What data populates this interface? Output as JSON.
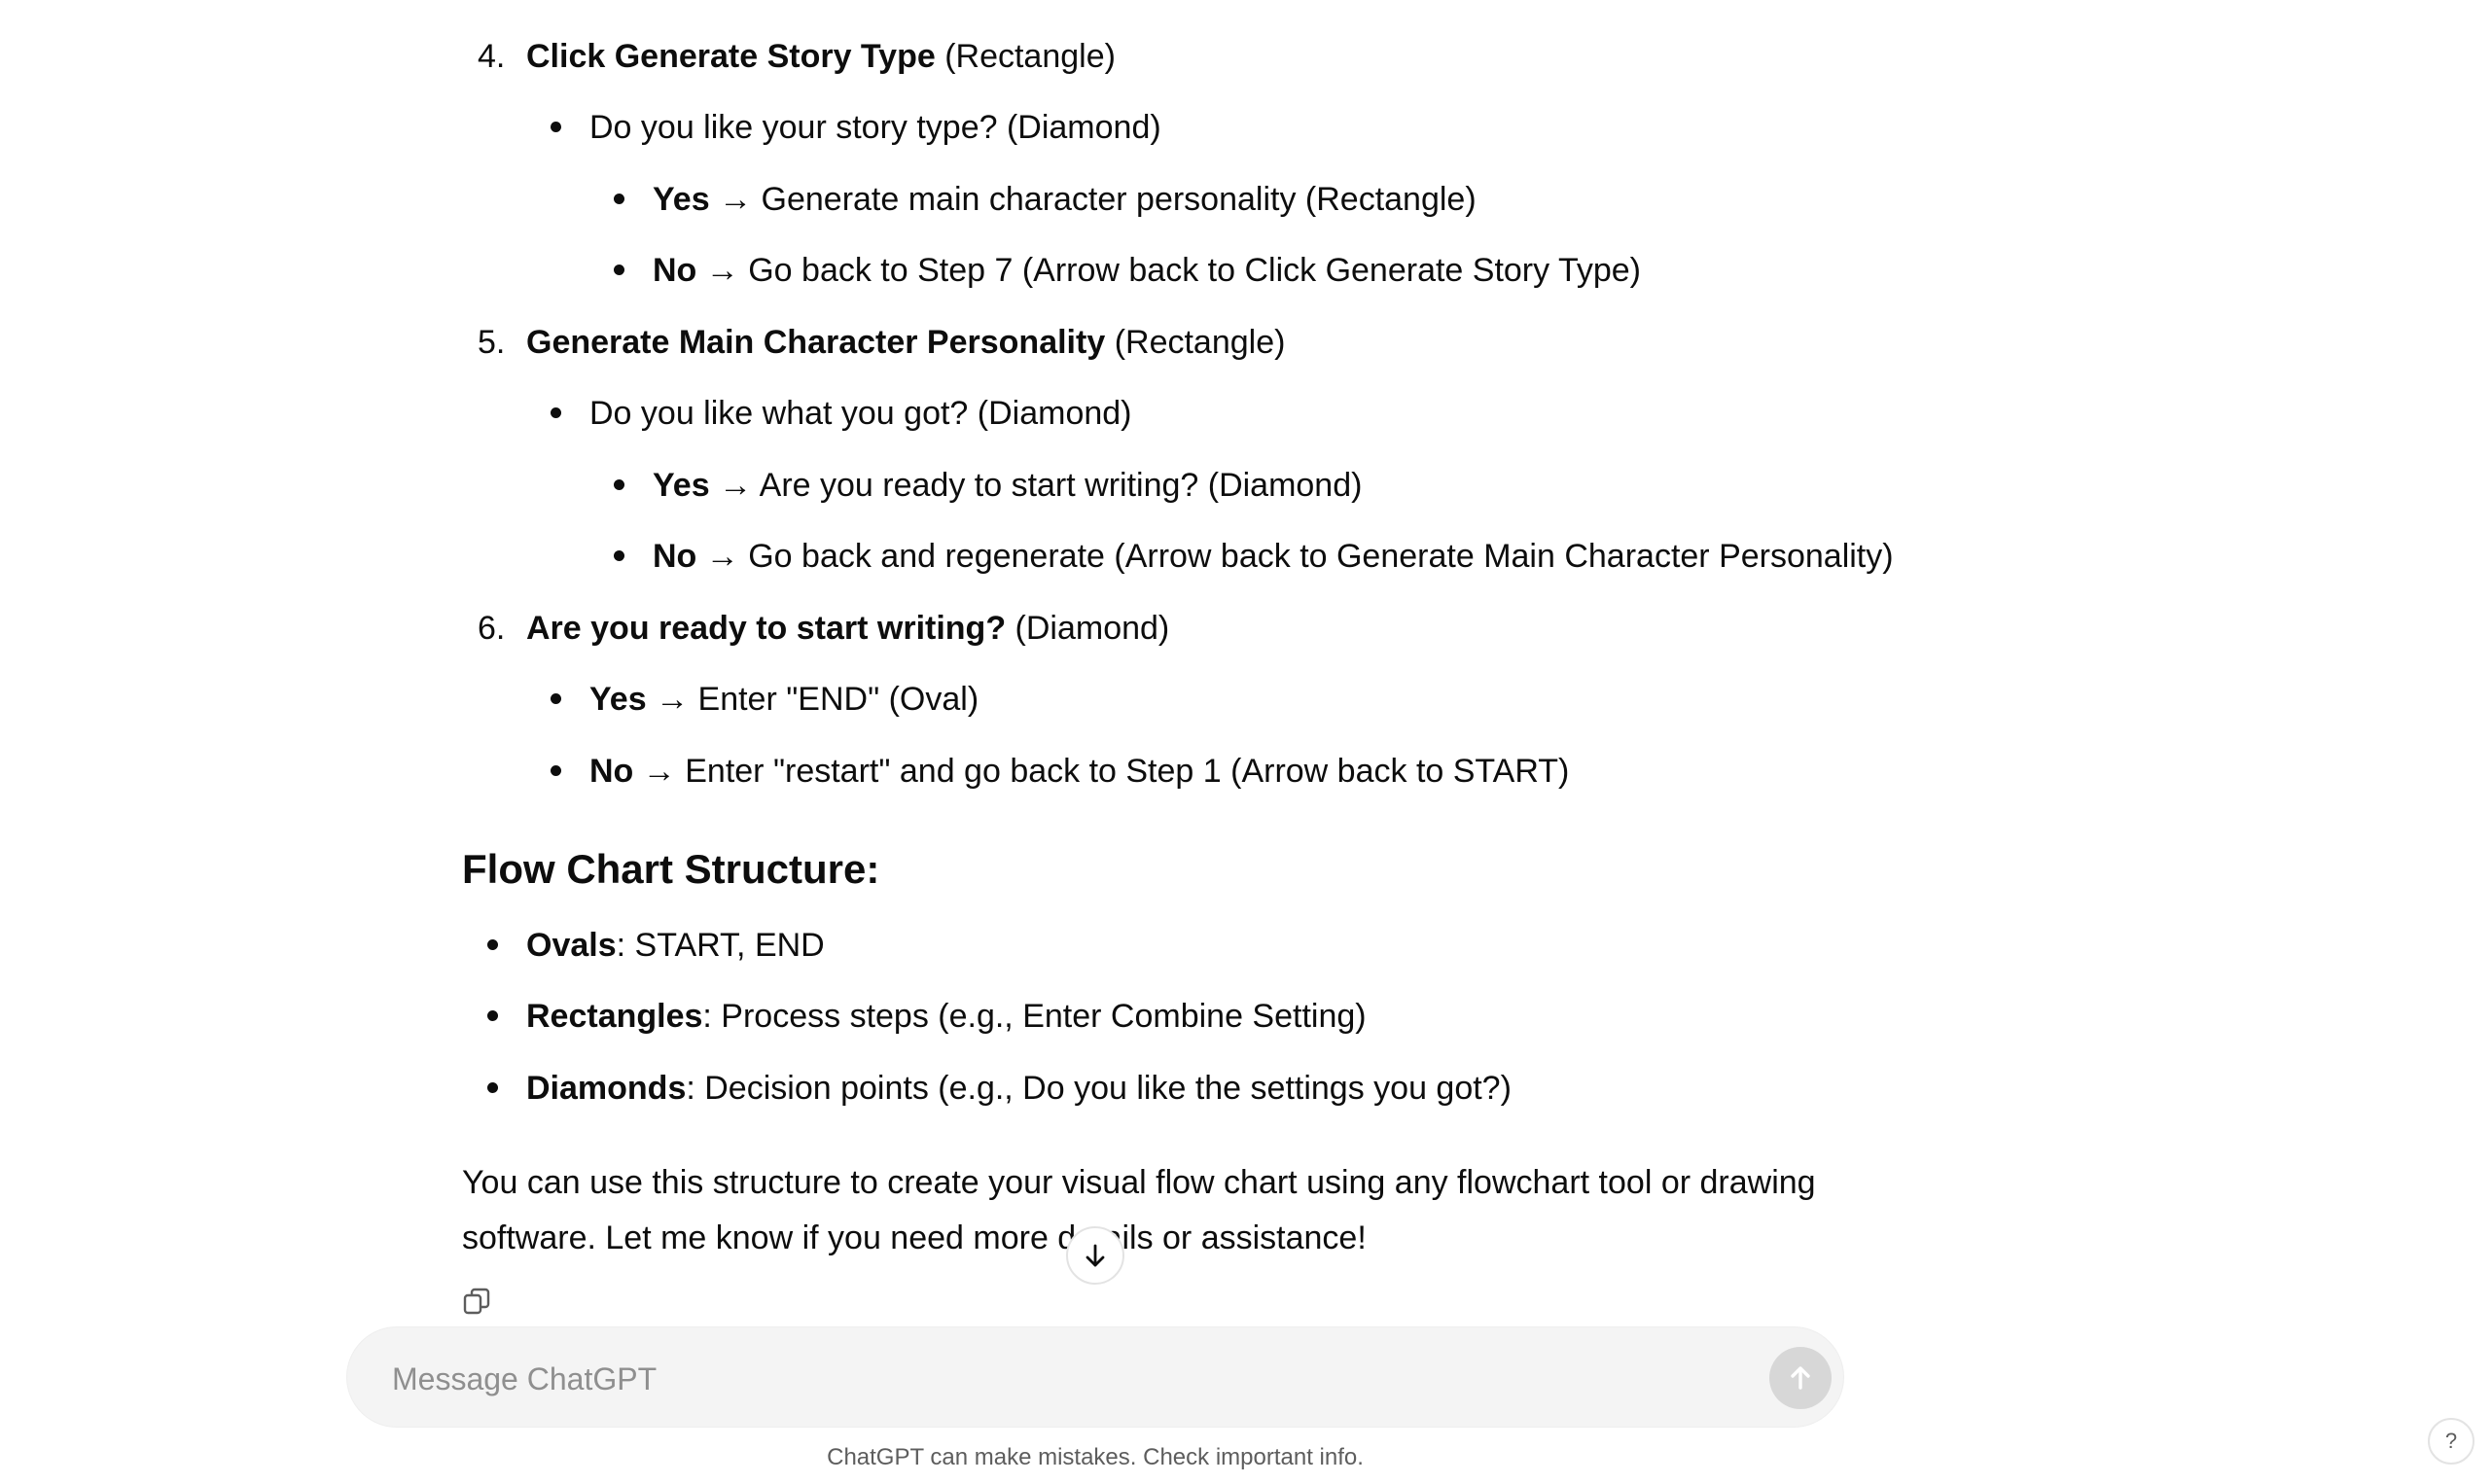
{
  "steps": [
    {
      "number": "4.",
      "title": "Click Generate Story Type",
      "shape": "(Rectangle)",
      "question": "Do you like your story type? (Diamond)",
      "yes": {
        "label": "Yes",
        "text": "→ Generate main character personality (Rectangle)"
      },
      "no": {
        "label": "No",
        "text": "→ Go back to Step 7 (Arrow back to Click Generate Story Type)"
      }
    },
    {
      "number": "5.",
      "title": "Generate Main Character Personality",
      "shape": "(Rectangle)",
      "question": "Do you like what you got? (Diamond)",
      "yes": {
        "label": "Yes",
        "text": "→ Are you ready to start writing? (Diamond)"
      },
      "no": {
        "label": "No",
        "text": "→ Go back and regenerate (Arrow back to Generate Main Character Personality)"
      }
    },
    {
      "number": "6.",
      "title": "Are you ready to start writing?",
      "shape": "(Diamond)",
      "yes": {
        "label": "Yes",
        "text": "→ Enter \"END\" (Oval)"
      },
      "no": {
        "label": "No",
        "text": "→ Enter \"restart\" and go back to Step 1 (Arrow back to START)"
      }
    }
  ],
  "structure": {
    "heading": "Flow Chart Structure:",
    "items": [
      {
        "label": "Ovals",
        "text": ": START, END"
      },
      {
        "label": "Rectangles",
        "text": ": Process steps (e.g., Enter Combine Setting)"
      },
      {
        "label": "Diamonds",
        "text": ": Decision points (e.g., Do you like the settings you got?)"
      }
    ]
  },
  "closing": {
    "line1": "You can use this structure to create your visual flow chart using any flowchart tool or drawing",
    "line2": "software. Let me know if you need more details or assistance!"
  },
  "composer": {
    "placeholder": "Message ChatGPT"
  },
  "footer": {
    "disclaimer": "ChatGPT can make mistakes. Check important info.",
    "help": "?"
  },
  "icons": {
    "copy": "copy-icon",
    "scroll_down": "arrow-down-icon",
    "send": "arrow-up-icon"
  }
}
